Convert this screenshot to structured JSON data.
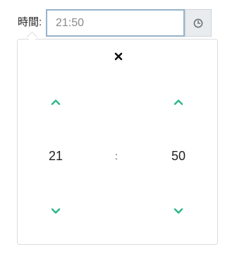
{
  "field": {
    "label": "時間:",
    "value": "21:50",
    "placeholder": ""
  },
  "picker": {
    "hours": "21",
    "separator": ":",
    "minutes": "50"
  },
  "icons": {
    "clock": "clock-icon",
    "close": "close-icon",
    "up": "chevron-up-icon",
    "down": "chevron-down-icon"
  },
  "colors": {
    "accent": "#2bb58a",
    "input_border": "#97b3c9",
    "button_bg": "#e9ecee"
  }
}
